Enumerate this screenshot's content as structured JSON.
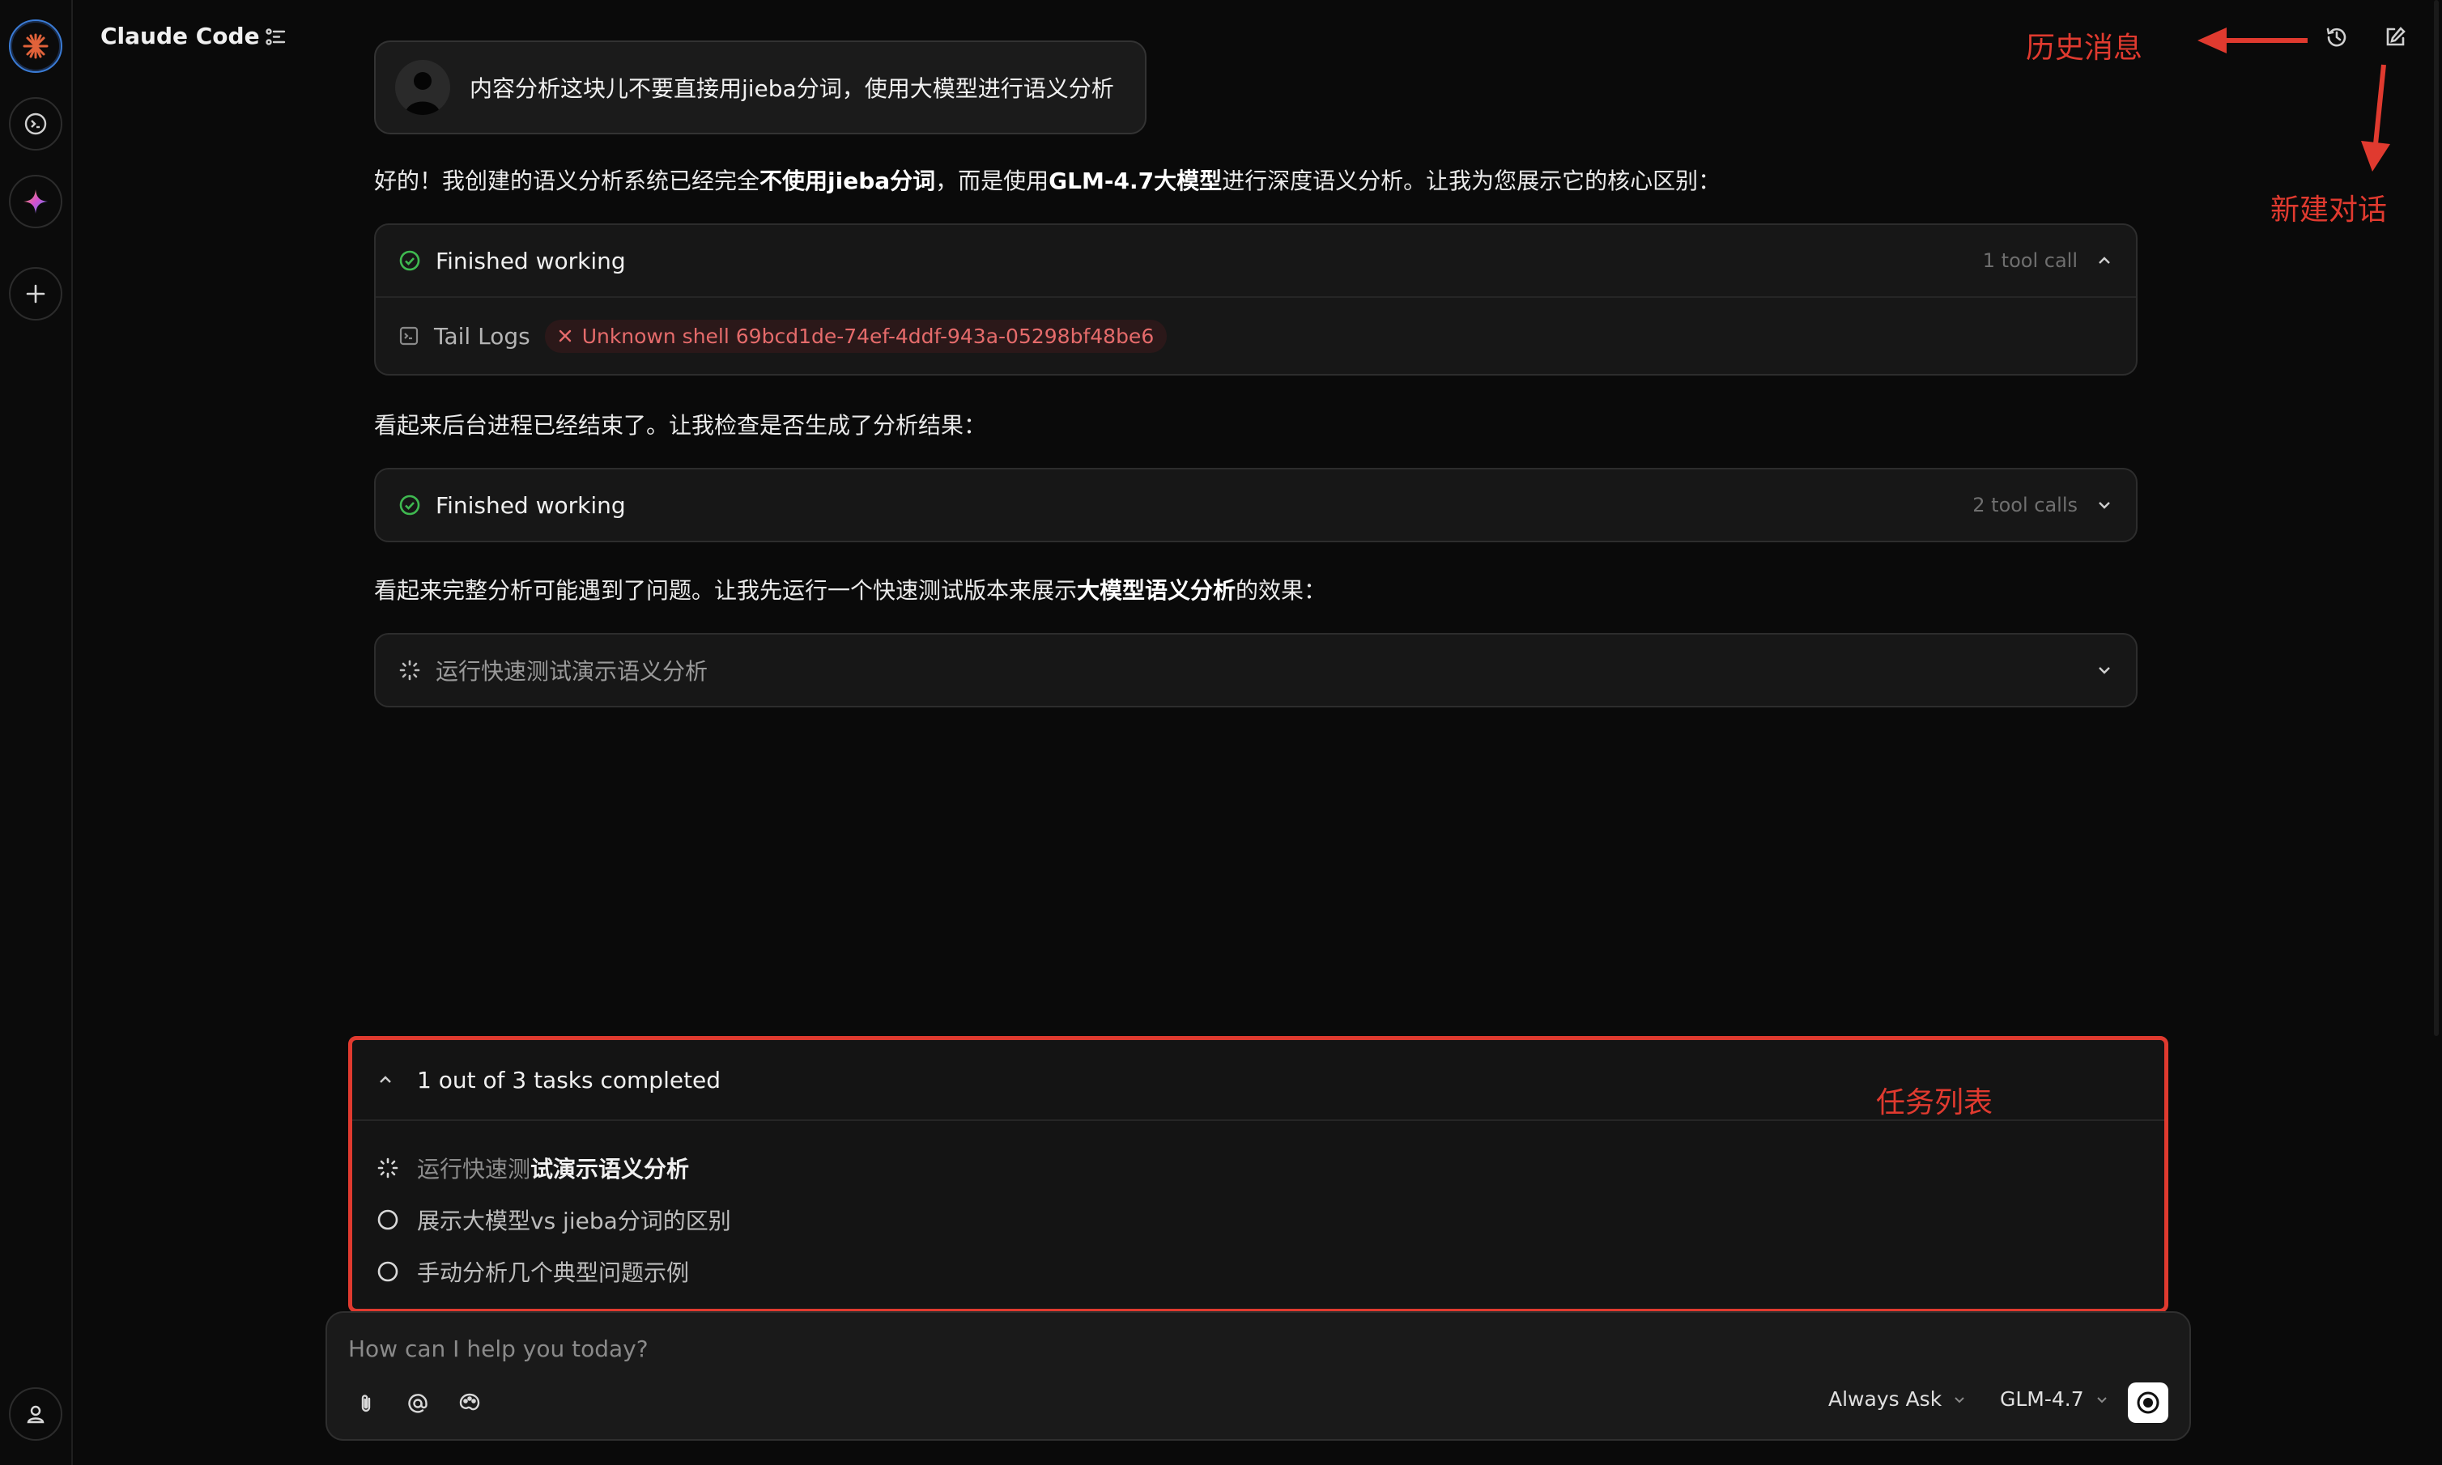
{
  "header": {
    "app_title": "Claude Code"
  },
  "rail": {
    "items": [
      "claude-logo",
      "terminal",
      "sparkle",
      "new"
    ],
    "account": "account"
  },
  "chat": {
    "user_message": "内容分析这块儿不要直接用jieba分词，使用大模型进行语义分析",
    "reply_1": {
      "p1": "好的！我创建的语义分析系统已经完全",
      "b1": "不使用jieba分词",
      "p2": "，而是使用",
      "b2": "GLM-4.7大模型",
      "p3": "进行深度语义分析。让我为您展示它的核心区别："
    },
    "card_1": {
      "title": "Finished working",
      "meta": "1 tool call",
      "tool_name": "Tail Logs",
      "error": "Unknown shell 69bcd1de-74ef-4ddf-943a-05298bf48be6"
    },
    "reply_2": "看起来后台进程已经结束了。让我检查是否生成了分析结果：",
    "card_2": {
      "title": "Finished working",
      "meta": "2 tool calls"
    },
    "reply_3": {
      "p1": "看起来完整分析可能遇到了问题。让我先运行一个快速测试版本来展示",
      "b1": "大模型语义分析",
      "p2": "的效果："
    },
    "card_3": {
      "title": "运行快速测试演示语义分析"
    }
  },
  "tasks": {
    "header": "1 out of 3 tasks completed",
    "items": [
      {
        "prefix": "运行快速测",
        "bold": "试演示语义分析",
        "status": "in-progress"
      },
      {
        "label": "展示大模型vs jieba分词的区别",
        "status": "pending"
      },
      {
        "label": "手动分析几个典型问题示例",
        "status": "pending"
      }
    ]
  },
  "composer": {
    "placeholder": "How can I help you today?",
    "permission_mode": "Always Ask",
    "model": "GLM-4.7"
  },
  "annotations": {
    "history": "历史消息",
    "new_chat": "新建对话",
    "task_list": "任务列表"
  },
  "colors": {
    "annotation_red": "#e03a2f",
    "success_green": "#3fb950",
    "error_red": "#e56b6b"
  }
}
